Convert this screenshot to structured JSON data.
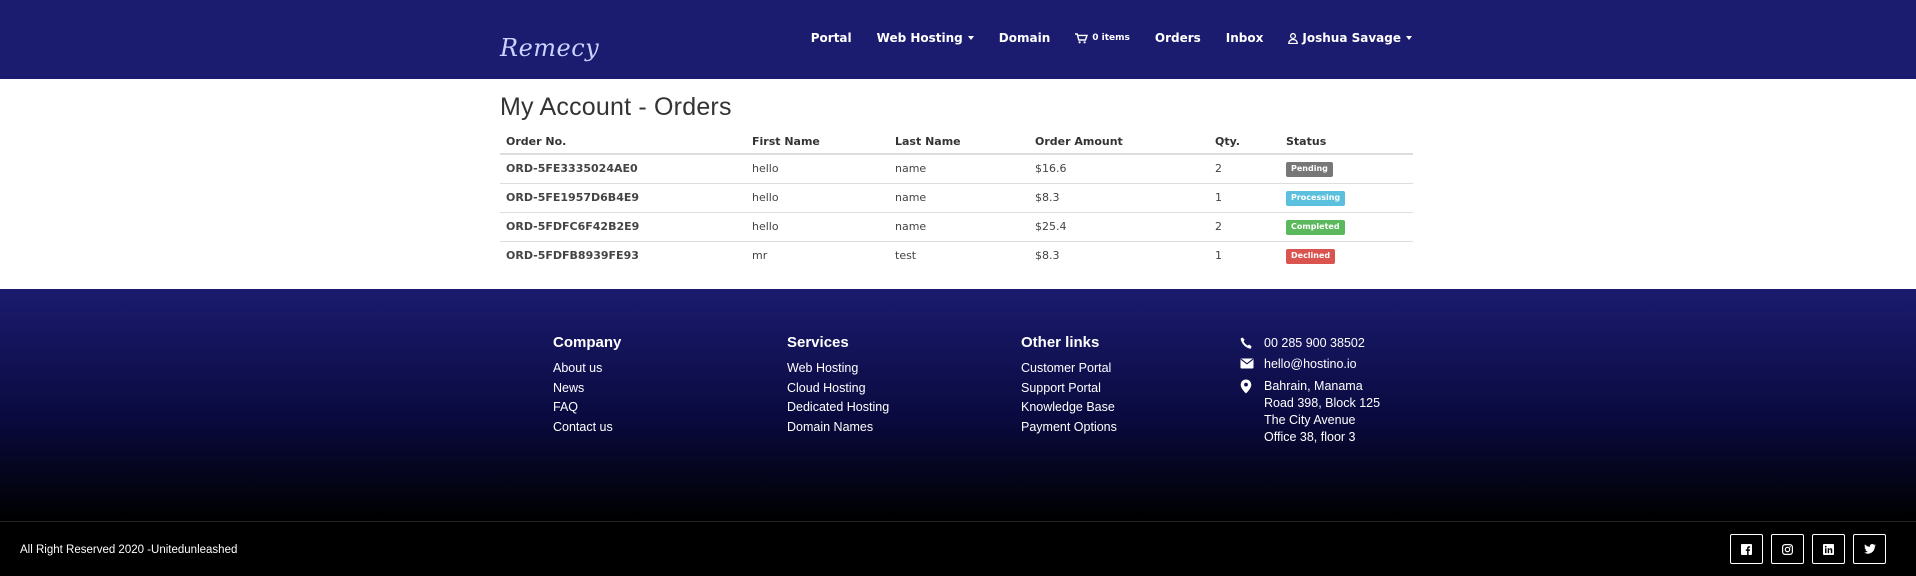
{
  "brand": {
    "logo_text": "Remecy",
    "nav_bg": "#1b1b6f"
  },
  "nav": {
    "portal": "Portal",
    "web_hosting": "Web Hosting",
    "domain": "Domain",
    "cart": "0 items",
    "orders": "Orders",
    "inbox": "Inbox",
    "user": "Joshua Savage"
  },
  "page": {
    "title": "My Account - Orders"
  },
  "orders_table": {
    "headers": [
      "Order No.",
      "First Name",
      "Last Name",
      "Order Amount",
      "Qty.",
      "Status"
    ],
    "rows": [
      {
        "order_no": "ORD-5FE3335024AE0",
        "first_name": "hello",
        "last_name": "name",
        "amount": "$16.6",
        "qty": "2",
        "status": "Pending",
        "status_color": "#777777"
      },
      {
        "order_no": "ORD-5FE1957D6B4E9",
        "first_name": "hello",
        "last_name": "name",
        "amount": "$8.3",
        "qty": "1",
        "status": "Processing",
        "status_color": "#5bc0de"
      },
      {
        "order_no": "ORD-5FDFC6F42B2E9",
        "first_name": "hello",
        "last_name": "name",
        "amount": "$25.4",
        "qty": "2",
        "status": "Completed",
        "status_color": "#5cb85c"
      },
      {
        "order_no": "ORD-5FDFB8939FE93",
        "first_name": "mr",
        "last_name": "test",
        "amount": "$8.3",
        "qty": "1",
        "status": "Declined",
        "status_color": "#d9534f"
      }
    ]
  },
  "footer": {
    "company": {
      "heading": "Company",
      "links": [
        "About us",
        "News",
        "FAQ",
        "Contact us"
      ]
    },
    "services": {
      "heading": "Services",
      "links": [
        "Web Hosting",
        "Cloud Hosting",
        "Dedicated Hosting",
        "Domain Names"
      ]
    },
    "other_links": {
      "heading": "Other links",
      "links": [
        "Customer Portal",
        "Support Portal",
        "Knowledge Base",
        "Payment Options"
      ]
    },
    "contact": {
      "phone": "00 285 900 38502",
      "email": "hello@hostino.io",
      "address": [
        "Bahrain, Manama",
        "Road 398, Block 125",
        "The City Avenue",
        "Office 38, floor 3"
      ]
    }
  },
  "bottom": {
    "copyright": "All Right Reserved 2020 -Unitedunleashed",
    "socials": [
      "facebook-icon",
      "instagram-icon",
      "linkedin-icon",
      "twitter-icon"
    ]
  }
}
